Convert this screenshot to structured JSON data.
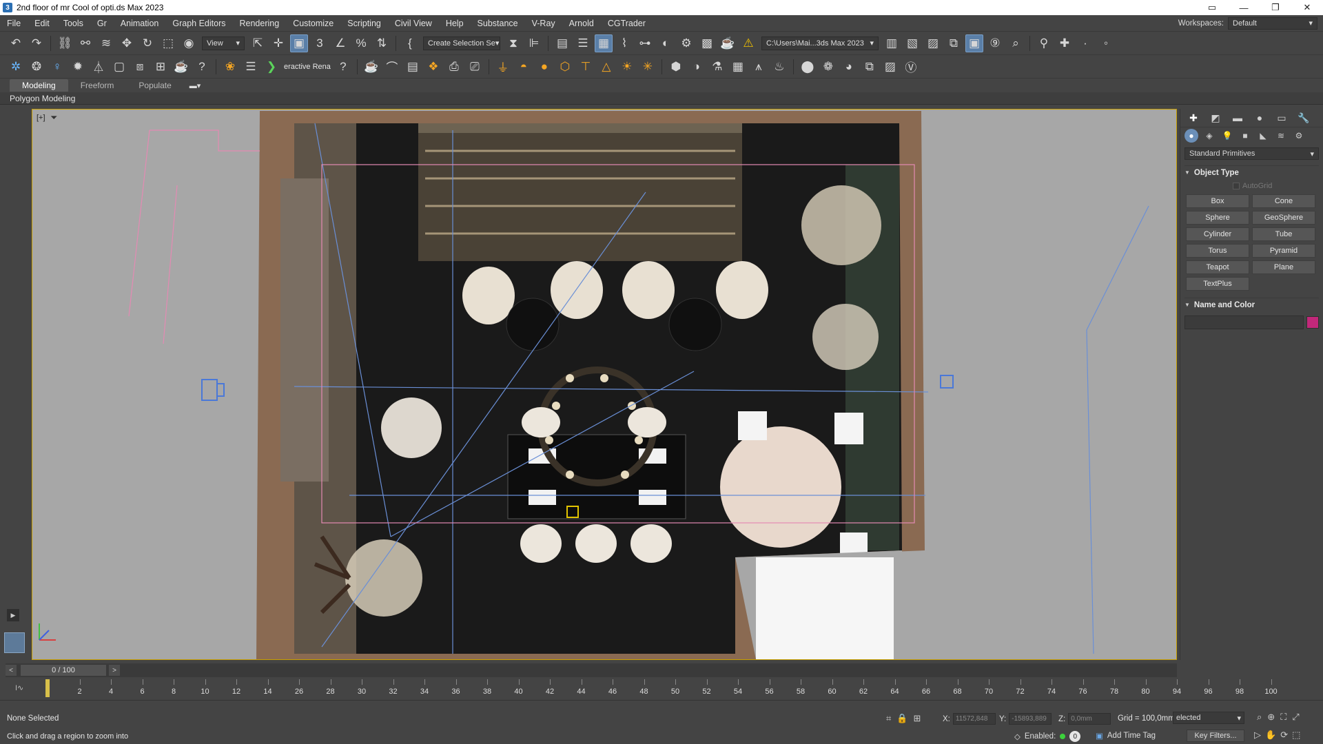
{
  "window": {
    "title": "2nd floor of mr Cool of opti.ds Max 2023",
    "minimize": "—",
    "restore": "❐",
    "close": "✕"
  },
  "menu": {
    "items": [
      "File",
      "Edit",
      "Tools",
      "Gr",
      "Animation",
      "Graph Editors",
      "Rendering",
      "Customize",
      "Scripting",
      "Civil View",
      "Help",
      "Substance",
      "V-Ray",
      "Arnold",
      "CGTrader"
    ],
    "workspaces_label": "Workspaces:",
    "workspaces_value": "Default"
  },
  "toolbar_main": {
    "view_dropdown": "View",
    "selection_set": "Create Selection Se",
    "project_path": "C:\\Users\\Mai...3ds Max 2023"
  },
  "toolbar_render": {
    "interactive_label": "eractive Rena"
  },
  "ribbon": {
    "tabs": [
      "Modeling",
      "Freeform",
      "Populate"
    ],
    "active_tab": "Modeling",
    "sub_label": "Polygon Modeling"
  },
  "viewport": {
    "label": "[+]"
  },
  "command_panel": {
    "category": "Standard Primitives",
    "object_type_title": "Object Type",
    "autogrid_label": "AutoGrid",
    "buttons": [
      "Box",
      "Cone",
      "Sphere",
      "GeoSphere",
      "Cylinder",
      "Tube",
      "Torus",
      "Pyramid",
      "Teapot",
      "Plane",
      "TextPlus"
    ],
    "name_color_title": "Name and Color",
    "color": "#c2287a"
  },
  "timeline": {
    "position": "0 / 100",
    "ticks": [
      0,
      2,
      4,
      6,
      8,
      10,
      12,
      14,
      26,
      28,
      30,
      32,
      34,
      36,
      38,
      40,
      42,
      44,
      46,
      48,
      50,
      52,
      54,
      56,
      58,
      60,
      62,
      64,
      66,
      68,
      70,
      72,
      74,
      76,
      78,
      80,
      94,
      96,
      98,
      100
    ],
    "tick_labels": [
      "2",
      "4",
      "6",
      "8",
      "10",
      "12",
      "14",
      "26",
      "28",
      "30",
      "32",
      "34",
      "36",
      "38",
      "40",
      "42",
      "44",
      "46",
      "48",
      "50",
      "52",
      "54",
      "56",
      "58",
      "60",
      "62",
      "64",
      "66",
      "68",
      "70",
      "72",
      "74",
      "76",
      "78",
      "80",
      "94",
      "96",
      "98",
      "100"
    ]
  },
  "status": {
    "selection": "None Selected",
    "prompt": "Click and drag a region to zoom into",
    "x_label": "X:",
    "x_value": "11572,848",
    "y_label": "Y:",
    "y_value": "-15893,889",
    "z_label": "Z:",
    "z_value": "0,0mm",
    "grid": "Grid = 100,0mm",
    "selected_dropdown": "elected",
    "enabled_label": "Enabled:",
    "enabled_count": "0",
    "add_time_tag": "Add Time Tag",
    "key_filters": "Key Filters..."
  },
  "colors": {
    "ui_bg": "#444444",
    "viewport_bg": "#a7a7a7",
    "accent_blue": "#5a7fa8",
    "warning_yellow": "#f2c200"
  }
}
